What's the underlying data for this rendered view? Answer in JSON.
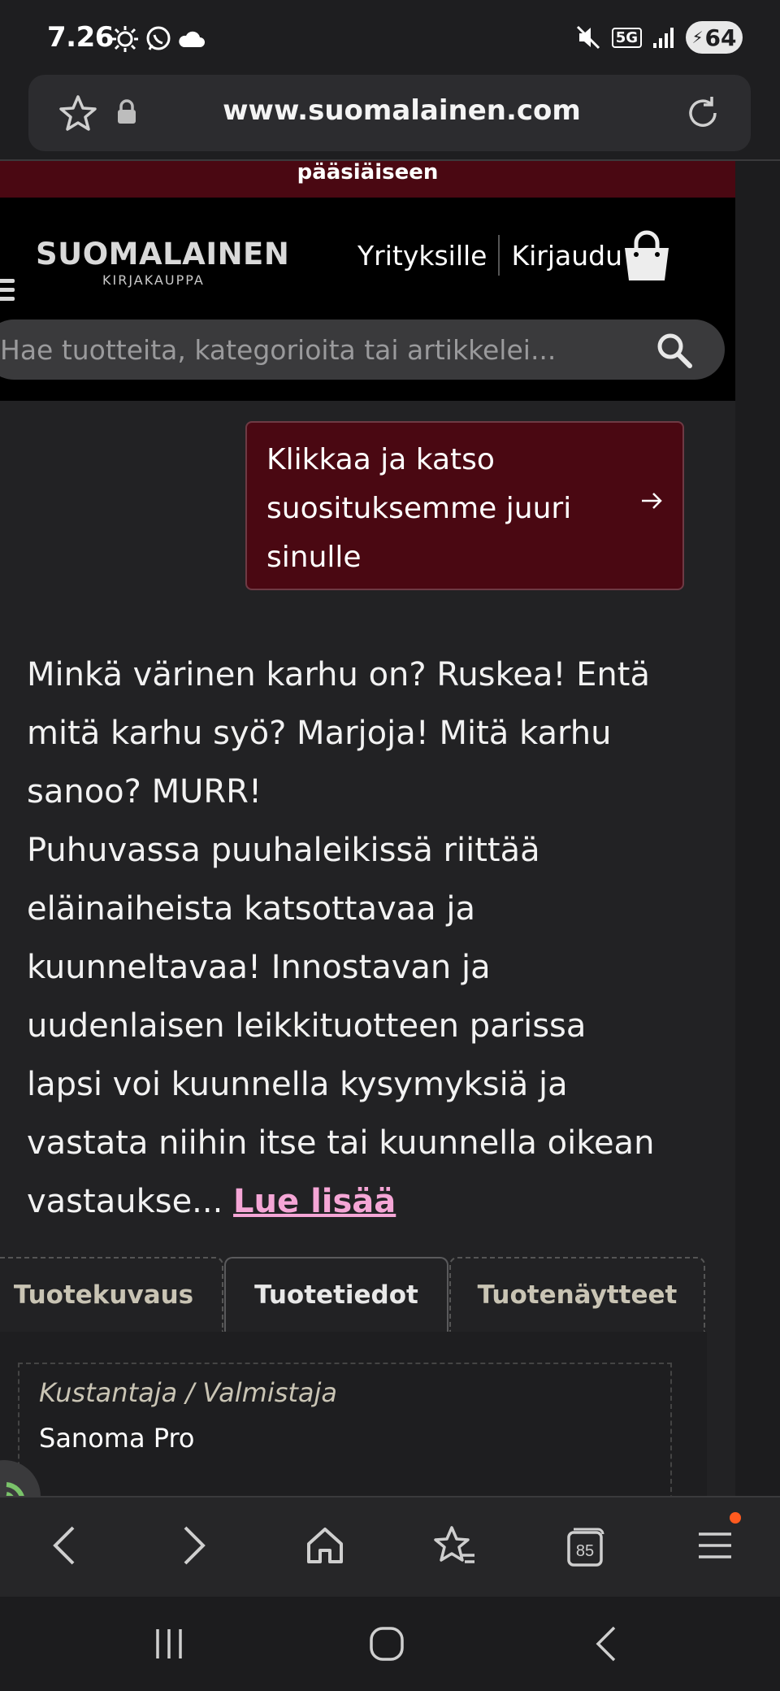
{
  "status_bar": {
    "time": "7.26",
    "network": "5G",
    "battery": "64",
    "icons": [
      "brightness-icon",
      "whatsapp-icon",
      "cloud-icon",
      "mute-icon",
      "signal-icon",
      "battery-icon"
    ]
  },
  "browser": {
    "url": "www.suomalainen.com",
    "tab_count": "85",
    "icons": [
      "star-icon",
      "lock-icon",
      "reload-icon",
      "back-icon",
      "forward-icon",
      "home-icon",
      "bookmarks-icon",
      "tabs-icon",
      "menu-icon"
    ]
  },
  "site": {
    "promo_text": "pääsiäiseen",
    "logo_main": "SUOMALAINEN",
    "logo_sub": "KIRJAKAUPPA",
    "nav_business": "Yrityksille",
    "nav_login": "Kirjaudu",
    "search_placeholder": "Hae tuotteita, kategorioita tai artikkelei...",
    "recommendation_button": "Klikkaa ja katso suosituksemme juuri sinulle",
    "description_lines": [
      "Minkä värinen karhu on? Ruskea! Entä",
      "mitä karhu syö? Marjoja! Mitä karhu",
      "sanoo? MURR!",
      "Puhuvassa puuhaleikissä riittää",
      "eläinaiheista katsottavaa ja",
      "kuunneltavaa! Innostavan ja",
      "uudenlaisen leikkituotteen parissa",
      "lapsi voi kuunnella kysymyksiä ja",
      "vastata niihin itse tai kuunnella oikean"
    ],
    "description_tail": "vastaukse...",
    "read_more": "Lue lisää",
    "tabs": [
      "Tuotekuvaus",
      "Tuotetiedot",
      "Tuotenäytteet"
    ],
    "active_tab": "Tuotetiedot",
    "details": {
      "label": "Kustantaja / Valmistaja",
      "value": "Sanoma Pro"
    }
  },
  "colors": {
    "brand_burgundy": "#4a0812",
    "link_pink": "#f5a6d6",
    "notification": "#ff5a1f"
  }
}
